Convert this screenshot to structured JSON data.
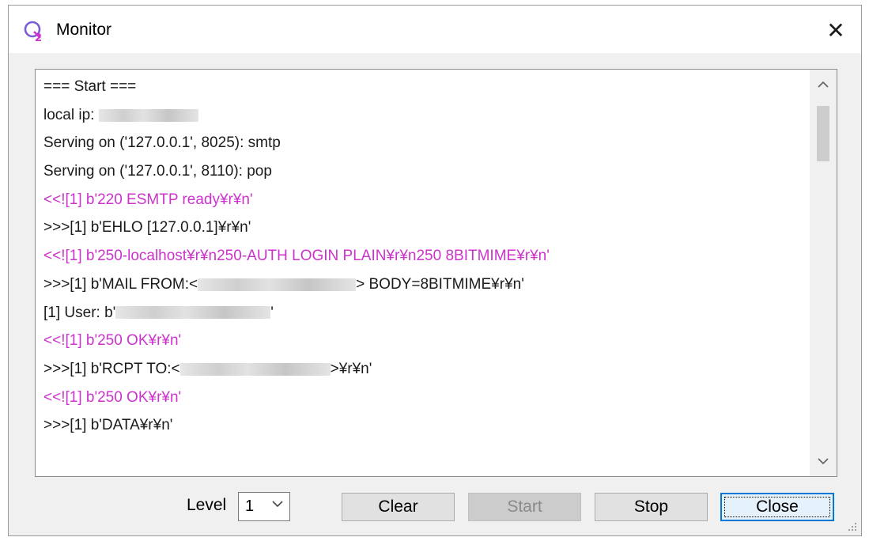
{
  "window": {
    "title": "Monitor",
    "close_glyph": "✕",
    "icon": "q2-app-icon",
    "accent_color": "#cc33cc"
  },
  "log": {
    "lines": [
      {
        "text": "=== Start ===",
        "kind": "info"
      },
      {
        "text": "local ip: ",
        "kind": "info",
        "redacted": true
      },
      {
        "text": "Serving on ('127.0.0.1', 8025): smtp",
        "kind": "info"
      },
      {
        "text": "Serving on ('127.0.0.1', 8110): pop",
        "kind": "info"
      },
      {
        "text": "<<![1] b'220 ESMTP ready¥r¥n'",
        "kind": "rx"
      },
      {
        "text": ">>>[1] b'EHLO [127.0.0.1]¥r¥n'",
        "kind": "tx"
      },
      {
        "text": "<<![1] b'250-localhost¥r¥n250-AUTH LOGIN PLAIN¥r¥n250 8BITMIME¥r¥n'",
        "kind": "rx"
      },
      {
        "text_before": ">>>[1] b'MAIL FROM:<",
        "text_after": "> BODY=8BITMIME¥r¥n'",
        "kind": "tx",
        "redacted": true
      },
      {
        "text_before": "[1] User: b'",
        "text_after": "'",
        "kind": "info",
        "redacted": true
      },
      {
        "text": "<<![1] b'250 OK¥r¥n'",
        "kind": "rx"
      },
      {
        "text_before": ">>>[1] b'RCPT TO:<",
        "text_after": ">¥r¥n'",
        "kind": "tx",
        "redacted": true
      },
      {
        "text": "<<![1] b'250 OK¥r¥n'",
        "kind": "rx"
      },
      {
        "text": ">>>[1] b'DATA¥r¥n'",
        "kind": "tx"
      }
    ],
    "scroll_up_glyph": "^",
    "scroll_down_glyph": "v"
  },
  "controls": {
    "level_label": "Level",
    "level_value": "1",
    "clear_label": "Clear",
    "start_label": "Start",
    "stop_label": "Stop",
    "close_label": "Close"
  }
}
